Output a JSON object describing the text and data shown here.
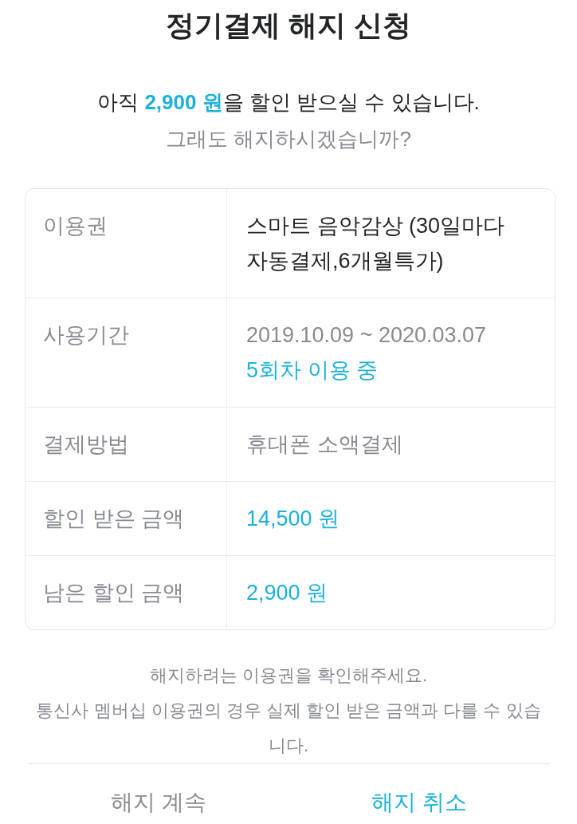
{
  "title": "정기결제 해지 신청",
  "notice": "아직 **2,900 원**을 할인 받으실 수 있습니다.",
  "question": "그래도 해지하시겠습니까?",
  "details": [
    {
      "label": "이용권",
      "values": [
        {
          "text": "스마트 음악감상 (30일마다 자동결제,6개월특가)",
          "kind": "strong"
        }
      ]
    },
    {
      "label": "사용기간",
      "values": [
        {
          "text": "2019.10.09 ~ 2020.03.07",
          "kind": "muted"
        },
        {
          "text": "5회차 이용 중",
          "kind": "accent"
        }
      ]
    },
    {
      "label": "결제방법",
      "values": [
        {
          "text": "휴대폰 소액결제",
          "kind": "muted"
        }
      ]
    },
    {
      "label": "할인 받은 금액",
      "values": [
        {
          "text": "14,500 원",
          "kind": "accent"
        }
      ]
    },
    {
      "label": "남은 할인 금액",
      "values": [
        {
          "text": "2,900 원",
          "kind": "accent"
        }
      ]
    }
  ],
  "notes": [
    "해지하려는 이용권을 확인해주세요.",
    "통신사 멤버십 이용권의 경우 실제 할인 받은 금액과 다를 수 있습니다."
  ],
  "buttons": [
    {
      "label": "해지 계속",
      "kind": "secondary"
    },
    {
      "label": "해지 취소",
      "kind": "primary"
    }
  ]
}
